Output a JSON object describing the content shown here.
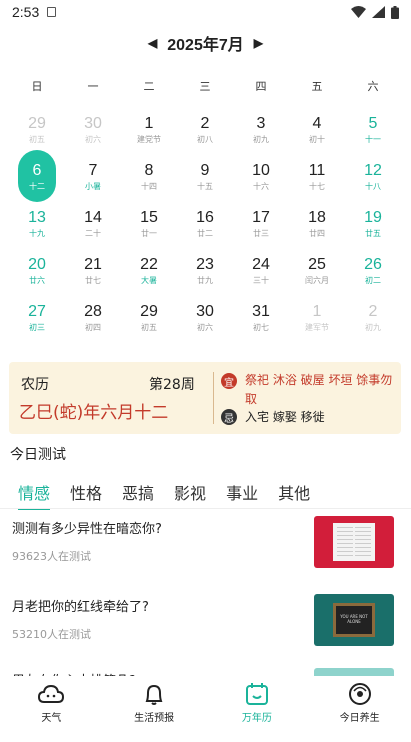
{
  "status_bar": {
    "time": "2:53"
  },
  "header": {
    "prev": "◀",
    "month": "2025年7月",
    "next": "▶"
  },
  "weekdays": [
    "日",
    "一",
    "二",
    "三",
    "四",
    "五",
    "六"
  ],
  "days": [
    {
      "day": "29",
      "lunar": "初五"
    },
    {
      "day": "30",
      "lunar": "初六"
    },
    {
      "day": "1",
      "lunar": "建党节"
    },
    {
      "day": "2",
      "lunar": "初八"
    },
    {
      "day": "3",
      "lunar": "初九"
    },
    {
      "day": "4",
      "lunar": "初十"
    },
    {
      "day": "5",
      "lunar": "十一"
    },
    {
      "day": "6",
      "lunar": "十二"
    },
    {
      "day": "7",
      "lunar": "小暑"
    },
    {
      "day": "8",
      "lunar": "十四"
    },
    {
      "day": "9",
      "lunar": "十五"
    },
    {
      "day": "10",
      "lunar": "十六"
    },
    {
      "day": "11",
      "lunar": "十七"
    },
    {
      "day": "12",
      "lunar": "十八"
    },
    {
      "day": "13",
      "lunar": "十九"
    },
    {
      "day": "14",
      "lunar": "二十"
    },
    {
      "day": "15",
      "lunar": "廿一"
    },
    {
      "day": "16",
      "lunar": "廿二"
    },
    {
      "day": "17",
      "lunar": "廿三"
    },
    {
      "day": "18",
      "lunar": "廿四"
    },
    {
      "day": "19",
      "lunar": "廿五"
    },
    {
      "day": "20",
      "lunar": "廿六"
    },
    {
      "day": "21",
      "lunar": "廿七"
    },
    {
      "day": "22",
      "lunar": "大暑"
    },
    {
      "day": "23",
      "lunar": "廿九"
    },
    {
      "day": "24",
      "lunar": "三十"
    },
    {
      "day": "25",
      "lunar": "闰六月"
    },
    {
      "day": "26",
      "lunar": "初二"
    },
    {
      "day": "27",
      "lunar": "初三"
    },
    {
      "day": "28",
      "lunar": "初四"
    },
    {
      "day": "29",
      "lunar": "初五"
    },
    {
      "day": "30",
      "lunar": "初六"
    },
    {
      "day": "31",
      "lunar": "初七"
    },
    {
      "day": "1",
      "lunar": "建军节"
    },
    {
      "day": "2",
      "lunar": "初九"
    }
  ],
  "almanac": {
    "lunar_label": "农历",
    "week_no": "第28周",
    "ganzhi": "乙巳(蛇)年六月十二",
    "yi_badge": "宜",
    "yi_text": "祭祀 沐浴 破屋 坏垣 馀事勿取",
    "ji_badge": "忌",
    "ji_text": "入宅 嫁娶 移徙"
  },
  "section_title": "今日测试",
  "tabs": [
    "情感",
    "性格",
    "恶搞",
    "影视",
    "事业",
    "其他"
  ],
  "articles": [
    {
      "title": "测测有多少异性在暗恋你?",
      "count": "93623人在测试"
    },
    {
      "title": "月老把你的红线牵给了?",
      "count": "53210人在测试"
    },
    {
      "title": "男友在你心中排第几?",
      "count": ""
    }
  ],
  "board_text": "YOU ARE NOT ALONE",
  "bottom_nav": [
    "天气",
    "生活预报",
    "万年历",
    "今日养生"
  ],
  "colors": {
    "accent": "#20c2a3",
    "red": "#c33a2a",
    "almanac_bg": "#fbf3df"
  }
}
